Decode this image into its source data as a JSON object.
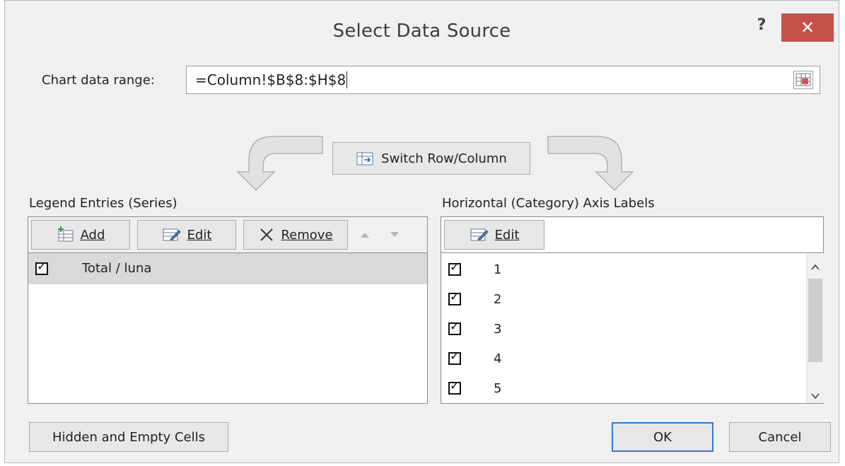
{
  "window": {
    "title": "Select Data Source"
  },
  "titlebar": {
    "help": "?",
    "close": "✕"
  },
  "range": {
    "label": "Chart data range:",
    "value": "=Column!$B$8:$H$8"
  },
  "switch_button": {
    "label": "Switch Row/Column"
  },
  "legend": {
    "heading": "Legend Entries (Series)",
    "buttons": {
      "add": "Add",
      "edit": "Edit",
      "remove": "Remove"
    },
    "items": [
      {
        "label": "Total / luna",
        "checked": true
      }
    ]
  },
  "axis": {
    "heading": "Horizontal (Category) Axis Labels",
    "edit": "Edit",
    "items": [
      {
        "label": "1",
        "checked": true
      },
      {
        "label": "2",
        "checked": true
      },
      {
        "label": "3",
        "checked": true
      },
      {
        "label": "4",
        "checked": true
      },
      {
        "label": "5",
        "checked": true
      }
    ]
  },
  "footer": {
    "hidden_cells": "Hidden and Empty Cells",
    "ok": "OK",
    "cancel": "Cancel"
  },
  "colors": {
    "close_button": "#c7504b",
    "selected_row": "#d9d9d9"
  }
}
